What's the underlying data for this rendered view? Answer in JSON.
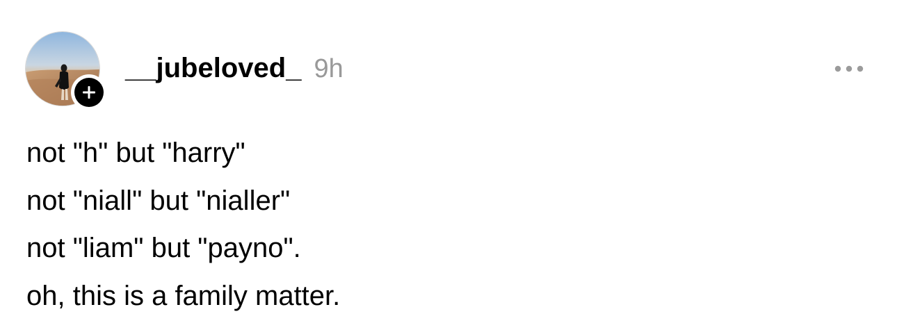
{
  "post": {
    "author": {
      "username": "__jubeloved_",
      "avatar_icon": "profile-photo-desert",
      "follow_icon": "plus-icon"
    },
    "timestamp": "9h",
    "more_icon": "more-horizontal-icon",
    "lines": [
      "not \"h\" but \"harry\"",
      "not \"niall\" but \"nialler\"",
      "not \"liam\" but \"payno\".",
      "oh, this is a family matter."
    ]
  },
  "colors": {
    "text": "#000000",
    "muted": "#999999",
    "badge": "#000000",
    "more_dots": "#9b9b9b"
  }
}
